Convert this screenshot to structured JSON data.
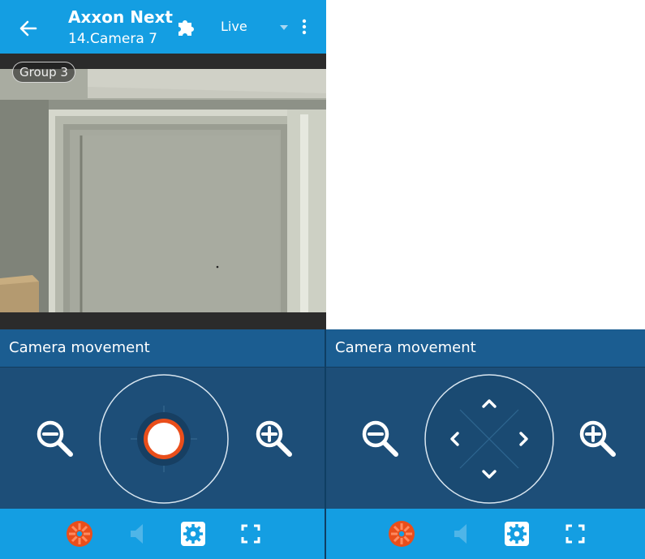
{
  "appbar": {
    "title": "Axxon Next",
    "subtitle": "14.Camera 7",
    "mode": "Live",
    "icons": {
      "back": "arrow-left-icon",
      "plugin": "puzzle-icon",
      "dropdown": "caret-down-icon",
      "more": "more-vert-icon"
    }
  },
  "video": {
    "group_label": "Group 3"
  },
  "panels": [
    {
      "title": "Camera movement",
      "control": "joystick"
    },
    {
      "title": "Camera movement",
      "control": "direction-pad"
    }
  ],
  "bottombar": {
    "icons": [
      "ptz-icon",
      "speaker-icon",
      "settings-icon",
      "fullscreen-icon"
    ]
  },
  "colors": {
    "appbar": "#149ee2",
    "panel_header": "#1b5d91",
    "panel_body": "#1d4e78",
    "accent_orange": "#e94e1b"
  }
}
